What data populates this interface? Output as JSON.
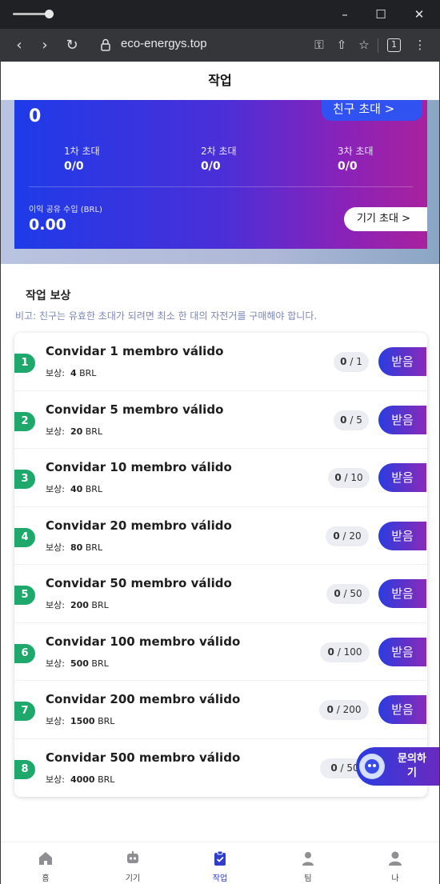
{
  "browser": {
    "url": "eco-energys.top",
    "tab_count": "1"
  },
  "page": {
    "title": "작업"
  },
  "hero": {
    "total": "0",
    "invite_friend": "친구 초대 >",
    "levels": [
      {
        "label": "1차 초대",
        "value": "0/0"
      },
      {
        "label": "2차 초대",
        "value": "0/0"
      },
      {
        "label": "3차 초대",
        "value": "0/0"
      }
    ],
    "profit_label": "이익 공유 수입  (BRL)",
    "profit_value": "0.00",
    "device_invite": "기기 초대 >"
  },
  "tasks": {
    "section_title": "작업 보상",
    "note": "비고: 친구는 유효한 초대가 되려면 최소 한 대의 자전거를 구매해야 합니다.",
    "reward_label": "보상:",
    "claim_label": "받음",
    "items": [
      {
        "num": "1",
        "title": "Convidar 1 membro válido",
        "reward": "4",
        "unit": "BRL",
        "done": "0",
        "total": "1"
      },
      {
        "num": "2",
        "title": "Convidar 5 membro válido",
        "reward": "20",
        "unit": "BRL",
        "done": "0",
        "total": "5"
      },
      {
        "num": "3",
        "title": "Convidar 10 membro válido",
        "reward": "40",
        "unit": "BRL",
        "done": "0",
        "total": "10"
      },
      {
        "num": "4",
        "title": "Convidar 20 membro válido",
        "reward": "80",
        "unit": "BRL",
        "done": "0",
        "total": "20"
      },
      {
        "num": "5",
        "title": "Convidar 50 membro válido",
        "reward": "200",
        "unit": "BRL",
        "done": "0",
        "total": "50"
      },
      {
        "num": "6",
        "title": "Convidar 100 membro válido",
        "reward": "500",
        "unit": "BRL",
        "done": "0",
        "total": "100"
      },
      {
        "num": "7",
        "title": "Convidar 200 membro válido",
        "reward": "1500",
        "unit": "BRL",
        "done": "0",
        "total": "200"
      },
      {
        "num": "8",
        "title": "Convidar 500 membro válido",
        "reward": "4000",
        "unit": "BRL",
        "done": "0",
        "total": "50"
      }
    ]
  },
  "contact": {
    "label_line1": "문의하",
    "label_line2": "기"
  },
  "tabbar": {
    "tabs": [
      {
        "label": "홈",
        "icon": "home-icon"
      },
      {
        "label": "기기",
        "icon": "robot-icon"
      },
      {
        "label": "작업",
        "icon": "clipboard-check-icon",
        "active": true
      },
      {
        "label": "팀",
        "icon": "team-icon"
      },
      {
        "label": "나",
        "icon": "user-icon"
      }
    ]
  },
  "colors": {
    "accent": "#2f3ccc",
    "badge_green": "#1fa86b",
    "hero_start": "#1e3be8",
    "hero_end": "#a8229e"
  }
}
